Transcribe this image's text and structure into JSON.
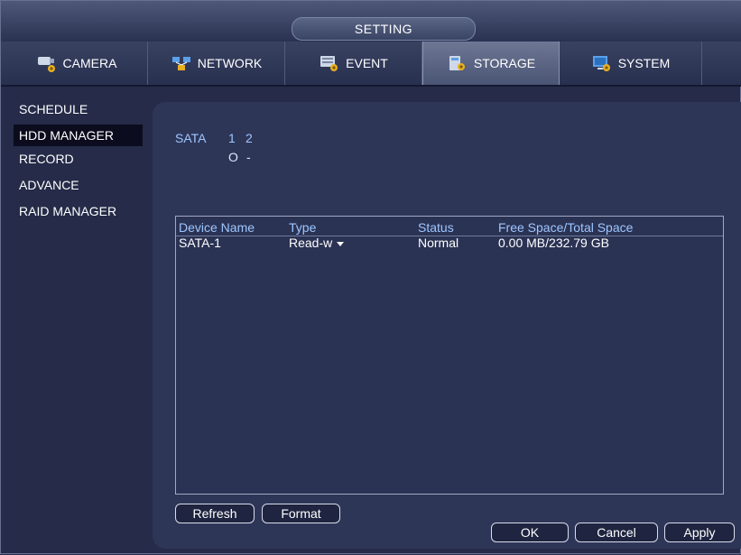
{
  "window": {
    "title": "SETTING"
  },
  "tabs": [
    {
      "label": "CAMERA",
      "icon": "camera-settings-icon",
      "active": false
    },
    {
      "label": "NETWORK",
      "icon": "network-settings-icon",
      "active": false
    },
    {
      "label": "EVENT",
      "icon": "event-settings-icon",
      "active": false
    },
    {
      "label": "STORAGE",
      "icon": "storage-settings-icon",
      "active": true
    },
    {
      "label": "SYSTEM",
      "icon": "system-settings-icon",
      "active": false
    }
  ],
  "sidebar": {
    "items": [
      {
        "label": "SCHEDULE",
        "active": false
      },
      {
        "label": "HDD MANAGER",
        "active": true
      },
      {
        "label": "RECORD",
        "active": false
      },
      {
        "label": "ADVANCE",
        "active": false
      },
      {
        "label": "RAID MANAGER",
        "active": false
      }
    ]
  },
  "sata": {
    "label": "SATA",
    "ports": [
      "1",
      "2"
    ],
    "status": [
      "O",
      "-"
    ]
  },
  "table": {
    "headers": [
      "Device Name",
      "Type",
      "Status",
      "Free Space/Total Space"
    ],
    "rows": [
      {
        "device": "SATA-1",
        "type": "Read-w",
        "status": "Normal",
        "space": "0.00 MB/232.79 GB"
      }
    ]
  },
  "buttons": {
    "refresh": "Refresh",
    "format": "Format",
    "ok": "OK",
    "cancel": "Cancel",
    "apply": "Apply"
  },
  "colors": {
    "background": "#252b48",
    "panel": "#2e3658",
    "accent_text": "#9ec6ff",
    "active_sidebar": "#0b0d1e"
  }
}
